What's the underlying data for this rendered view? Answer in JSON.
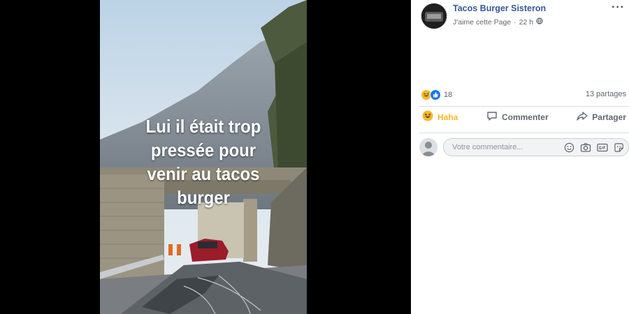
{
  "photo": {
    "caption_lines": [
      "Lui il était trop",
      "pressée pour",
      "venir au tacos",
      "burger"
    ]
  },
  "post": {
    "page_name": "Tacos Burger Sisteron",
    "like_page": "J'aime cette Page",
    "separator": "·",
    "time": "22 h",
    "more": "···",
    "reaction_count": "18",
    "shares": "13 partages"
  },
  "actions": {
    "haha": "Haha",
    "comment": "Commenter",
    "share": "Partager"
  },
  "comment_box": {
    "placeholder": "Votre commentaire..."
  },
  "colors": {
    "link": "#385898",
    "haha": "#f7b928",
    "like_blue": "#1877f2"
  },
  "icons": [
    "globe-icon",
    "haha-reaction-icon",
    "like-reaction-icon",
    "comment-icon",
    "share-icon",
    "emoji-icon",
    "camera-icon",
    "gif-icon",
    "sticker-icon"
  ]
}
